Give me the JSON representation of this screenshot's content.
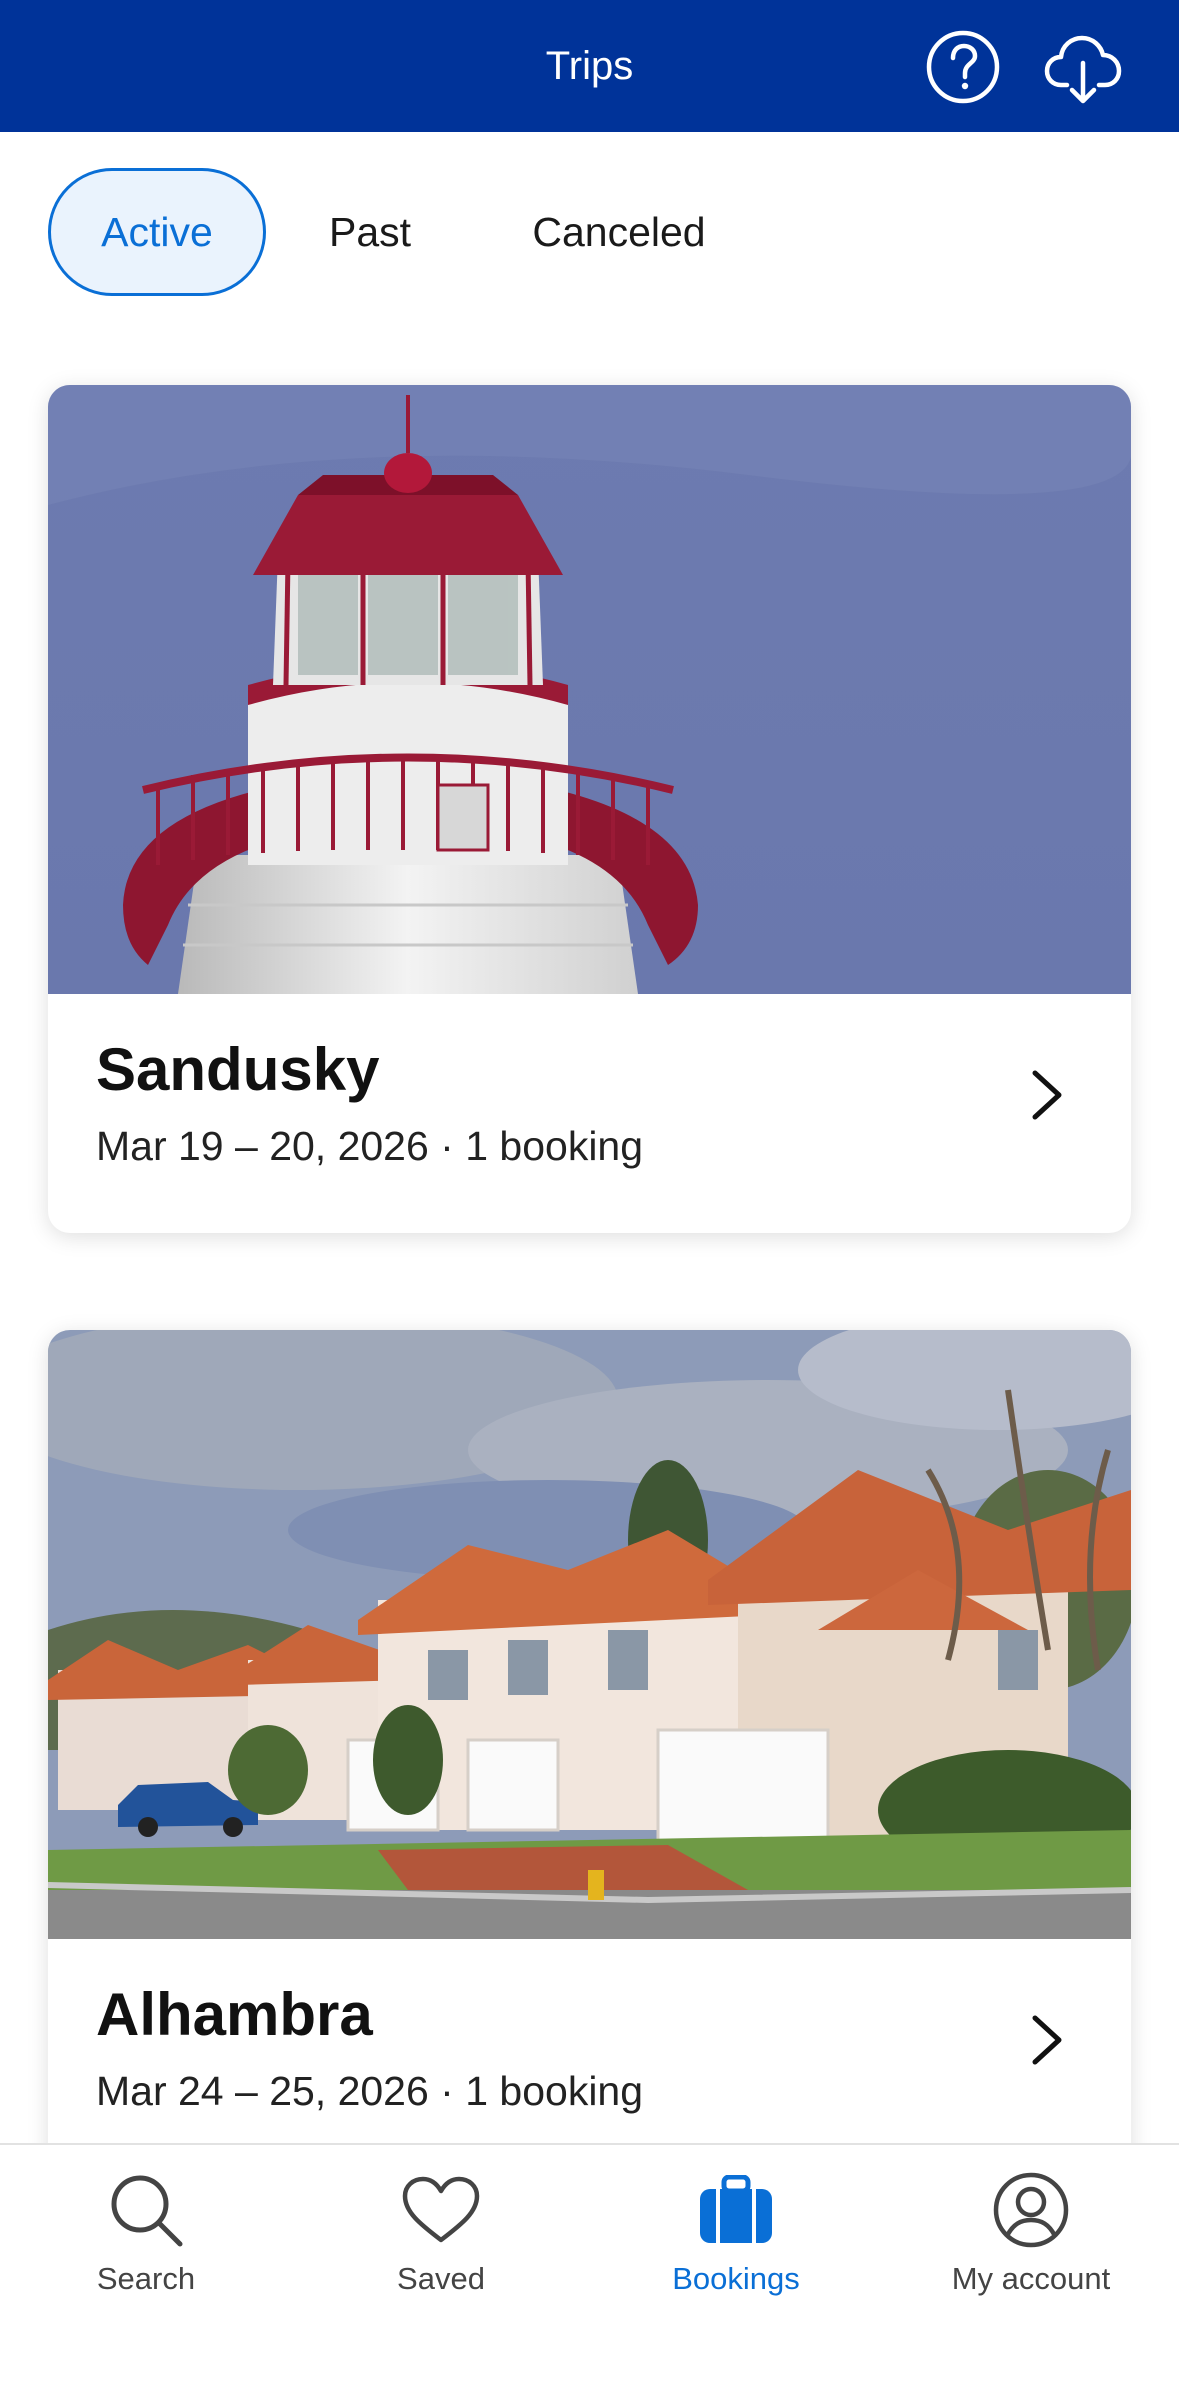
{
  "header": {
    "title": "Trips"
  },
  "tabs": [
    {
      "label": "Active",
      "selected": true
    },
    {
      "label": "Past",
      "selected": false
    },
    {
      "label": "Canceled",
      "selected": false
    }
  ],
  "trips": [
    {
      "name": "Sandusky",
      "meta": "Mar 19 – 20, 2026 · 1 booking",
      "image": "lighthouse"
    },
    {
      "name": "Alhambra",
      "meta": "Mar 24 – 25, 2026 · 1 booking",
      "image": "houses"
    }
  ],
  "bottom_nav": [
    {
      "label": "Search",
      "icon": "search-icon",
      "active": false
    },
    {
      "label": "Saved",
      "icon": "heart-icon",
      "active": false
    },
    {
      "label": "Bookings",
      "icon": "suitcase-icon",
      "active": true
    },
    {
      "label": "My account",
      "icon": "account-icon",
      "active": false
    }
  ],
  "colors": {
    "header": "#003399",
    "accent": "#0a6fd6",
    "tab_active_bg": "#eaf3fd"
  }
}
